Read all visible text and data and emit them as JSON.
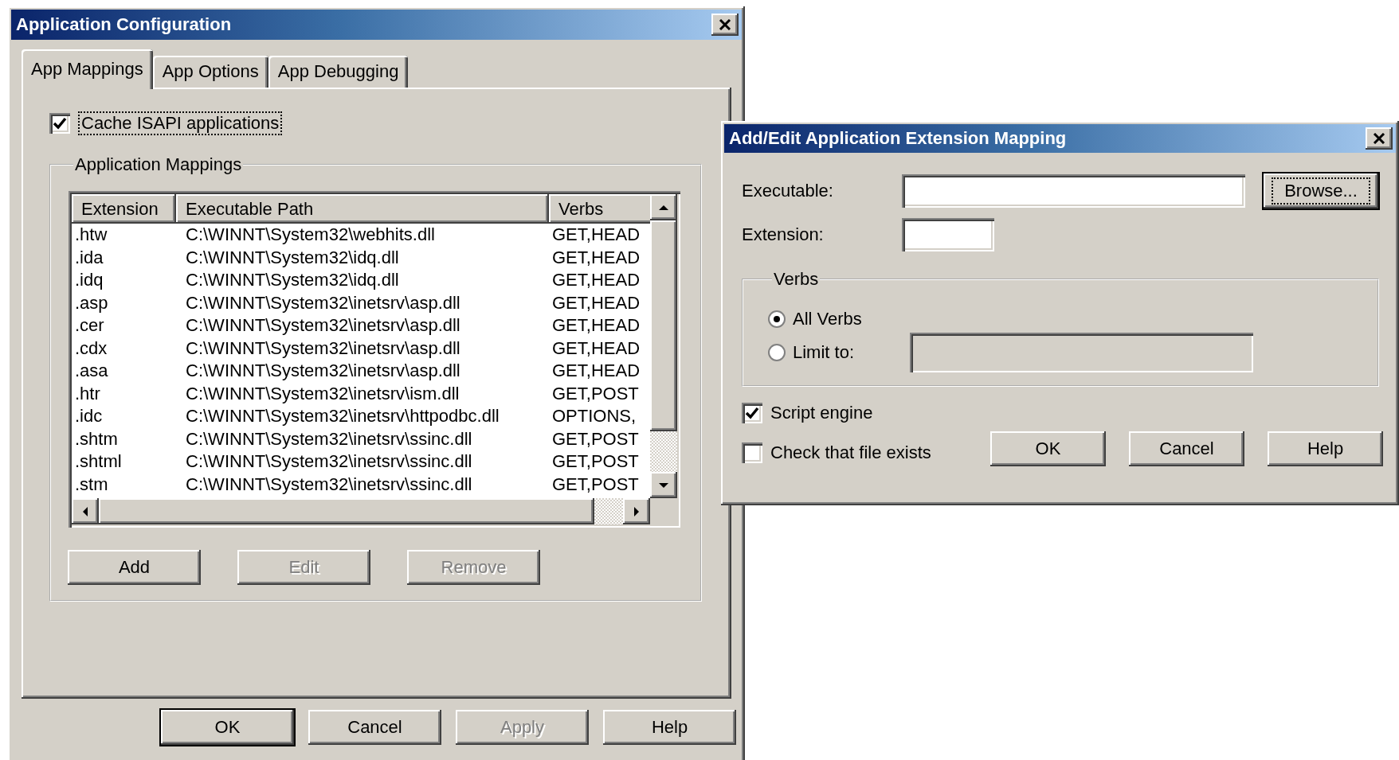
{
  "main_window": {
    "title": "Application Configuration",
    "tabs": [
      {
        "label": "App Mappings",
        "selected": true
      },
      {
        "label": "App Options",
        "selected": false
      },
      {
        "label": "App Debugging",
        "selected": false
      }
    ],
    "cache_isapi": {
      "label": "Cache ISAPI applications",
      "checked": true,
      "focused": true
    },
    "mappings_group": {
      "title": "Application Mappings",
      "table": {
        "columns": [
          "Extension",
          "Executable Path",
          "Verbs"
        ],
        "rows": [
          [
            ".htw",
            "C:\\WINNT\\System32\\webhits.dll",
            "GET,HEAD"
          ],
          [
            ".ida",
            "C:\\WINNT\\System32\\idq.dll",
            "GET,HEAD"
          ],
          [
            ".idq",
            "C:\\WINNT\\System32\\idq.dll",
            "GET,HEAD"
          ],
          [
            ".asp",
            "C:\\WINNT\\System32\\inetsrv\\asp.dll",
            "GET,HEAD"
          ],
          [
            ".cer",
            "C:\\WINNT\\System32\\inetsrv\\asp.dll",
            "GET,HEAD"
          ],
          [
            ".cdx",
            "C:\\WINNT\\System32\\inetsrv\\asp.dll",
            "GET,HEAD"
          ],
          [
            ".asa",
            "C:\\WINNT\\System32\\inetsrv\\asp.dll",
            "GET,HEAD"
          ],
          [
            ".htr",
            "C:\\WINNT\\System32\\inetsrv\\ism.dll",
            "GET,POST"
          ],
          [
            ".idc",
            "C:\\WINNT\\System32\\inetsrv\\httpodbc.dll",
            "OPTIONS,"
          ],
          [
            ".shtm",
            "C:\\WINNT\\System32\\inetsrv\\ssinc.dll",
            "GET,POST"
          ],
          [
            ".shtml",
            "C:\\WINNT\\System32\\inetsrv\\ssinc.dll",
            "GET,POST"
          ],
          [
            ".stm",
            "C:\\WINNT\\System32\\inetsrv\\ssinc.dll",
            "GET,POST"
          ]
        ]
      },
      "buttons": [
        {
          "label": "Add",
          "disabled": false
        },
        {
          "label": "Edit",
          "disabled": true
        },
        {
          "label": "Remove",
          "disabled": true
        }
      ]
    },
    "buttons": [
      {
        "label": "OK",
        "default": true,
        "disabled": false
      },
      {
        "label": "Cancel",
        "default": false,
        "disabled": false
      },
      {
        "label": "Apply",
        "default": false,
        "disabled": true
      },
      {
        "label": "Help",
        "default": false,
        "disabled": false
      }
    ]
  },
  "mapping_dialog": {
    "title": "Add/Edit Application Extension Mapping",
    "executable": {
      "label": "Executable:"
    },
    "browse_button": {
      "label": "Browse...",
      "default": true,
      "focused": true
    },
    "extension": {
      "label": "Extension:"
    },
    "verbs": {
      "title": "Verbs",
      "options": [
        {
          "label": "All Verbs",
          "selected": true
        },
        {
          "label": "Limit to:",
          "selected": false
        }
      ],
      "limit_field": {
        "disabled": true
      }
    },
    "checkboxes": [
      {
        "label": "Script engine",
        "checked": true
      },
      {
        "label": "Check that file exists",
        "checked": false
      }
    ],
    "buttons": [
      {
        "label": "OK",
        "default": false,
        "disabled": false
      },
      {
        "label": "Cancel",
        "default": false,
        "disabled": false
      },
      {
        "label": "Help",
        "default": false,
        "disabled": false
      }
    ]
  }
}
